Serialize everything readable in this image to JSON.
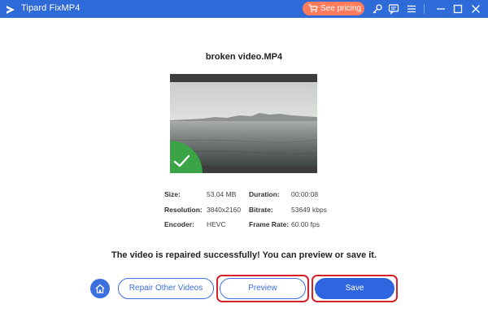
{
  "app": {
    "title": "Tipard FixMP4"
  },
  "titlebar": {
    "pricing_label": "See pricing"
  },
  "file": {
    "name": "broken video.MP4"
  },
  "info": {
    "size_label": "Size:",
    "size_value": "53.04 MB",
    "duration_label": "Duration:",
    "duration_value": "00:00:08",
    "resolution_label": "Resolution:",
    "resolution_value": "3840x2160",
    "bitrate_label": "Bitrate:",
    "bitrate_value": "53649 kbps",
    "encoder_label": "Encoder:",
    "encoder_value": "HEVC",
    "framerate_label": "Frame Rate:",
    "framerate_value": "60.00 fps"
  },
  "message": "The video is repaired successfully! You can preview or save it.",
  "actions": {
    "repair_other_label": "Repair Other Videos",
    "preview_label": "Preview",
    "save_label": "Save"
  },
  "colors": {
    "titlebar": "#2f6ad9",
    "pricing": "#ff7b5c",
    "accent": "#2f66e0",
    "success": "#3aa447",
    "highlight": "#d8202a"
  },
  "icons": [
    "app-logo-icon",
    "cart-icon",
    "key-icon",
    "chat-icon",
    "menu-icon",
    "minimize-icon",
    "maximize-icon",
    "close-icon",
    "checkmark-icon",
    "home-icon"
  ]
}
